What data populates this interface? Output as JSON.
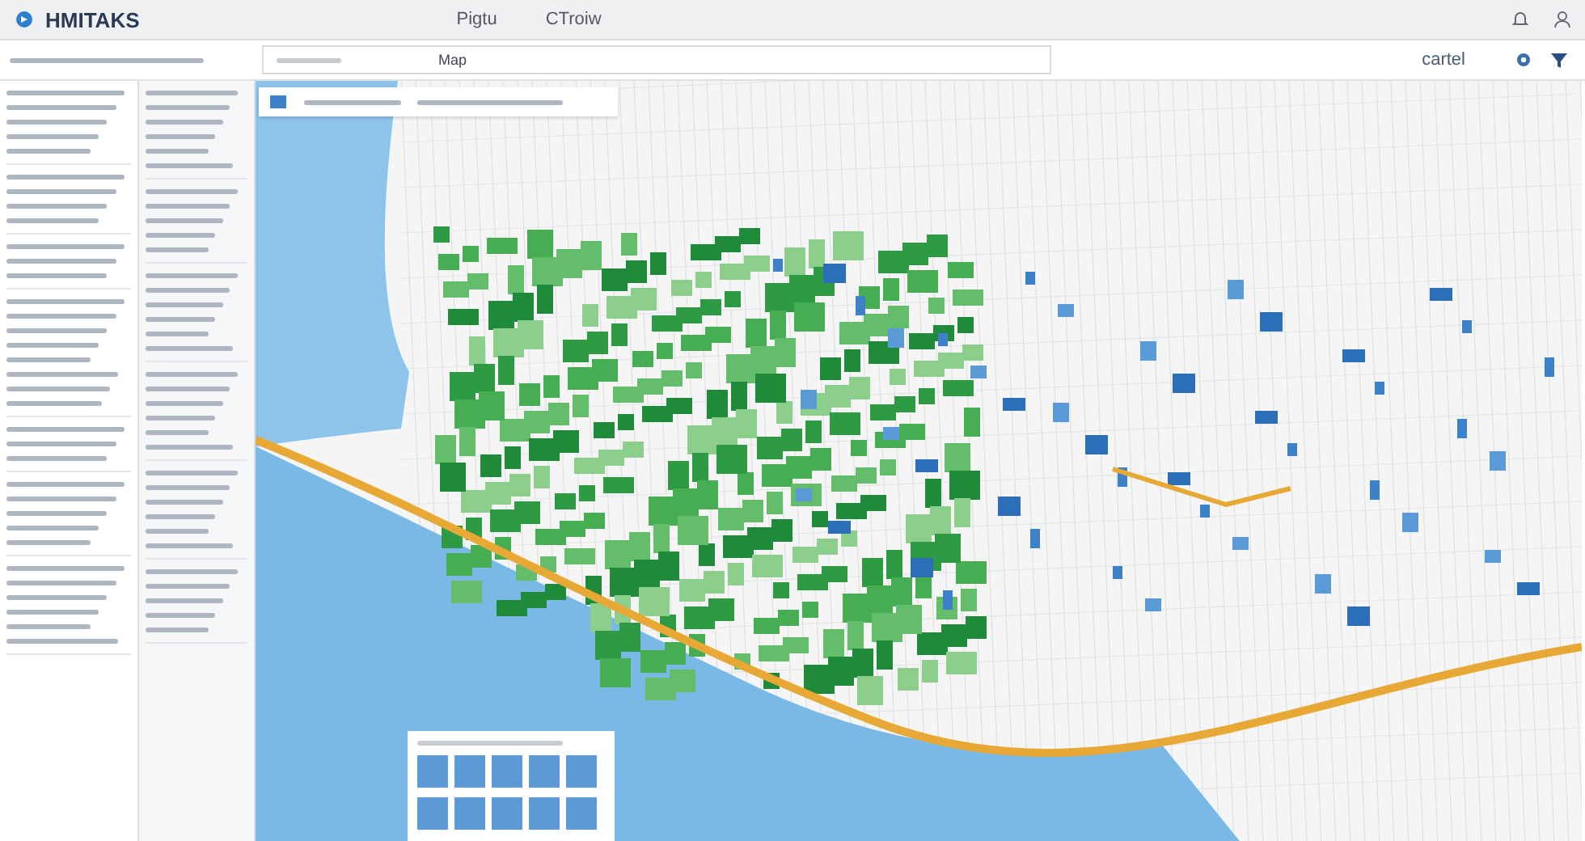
{
  "app": {
    "name": "HMITAKS"
  },
  "nav": [
    {
      "label": "Pigtu"
    },
    {
      "label": "CTroiw"
    }
  ],
  "search": {
    "label": "Map"
  },
  "account": {
    "label": "cartel"
  }
}
